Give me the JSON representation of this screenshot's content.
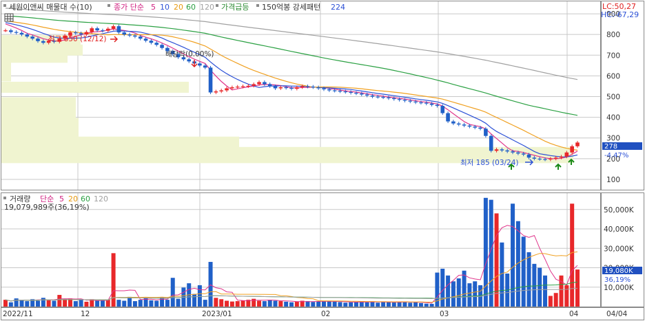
{
  "price_panel": {
    "legend": {
      "title": "세원이앤씨 매물대 수(10)",
      "ma_prefix": "종가 단순",
      "ma_periods": [
        "5",
        "10",
        "20",
        "60",
        "120"
      ],
      "ma_colors": [
        "#e0348a",
        "#2b50d6",
        "#f0a020",
        "#2aa042",
        "#a0a0a0"
      ],
      "price_spike": "가격급등",
      "strong_pattern": "150억봉 강세패턴",
      "strong_count": "224"
    },
    "lc_label": "LC:50,27",
    "hc_label": "HC:-67,29",
    "y_axis": {
      "ticks": [
        "900",
        "800",
        "700",
        "600",
        "500",
        "400",
        "300",
        "200",
        "100"
      ],
      "values": [
        900,
        800,
        700,
        600,
        500,
        400,
        300,
        200,
        100
      ],
      "range": [
        50,
        960
      ]
    },
    "current_price_tag": "278",
    "current_change_tag": "-4.47%",
    "annotations": {
      "high": "최고 850 (12/12)",
      "low": "최저 185 (03/24)",
      "dividend": "배당락(0.00%)"
    }
  },
  "volume_panel": {
    "legend": {
      "title": "거래량",
      "ma_prefix": "단순",
      "ma_periods": [
        "5",
        "20",
        "60",
        "120"
      ]
    },
    "info": "19,079,989주(36,19%)",
    "y_axis": {
      "ticks": [
        "50,000K",
        "40,000K",
        "30,000K",
        "20,000K",
        "10,000K"
      ],
      "values": [
        50000,
        40000,
        30000,
        20000,
        10000
      ],
      "range": [
        0,
        57000
      ]
    },
    "current_volume_tag": "19,080K",
    "current_ratio_tag": "36,19%"
  },
  "x_axis": {
    "labels": [
      "2022/11",
      "12",
      "2023/01",
      "02",
      "03",
      "04"
    ],
    "right_label": "04/04"
  },
  "colors": {
    "up": "#e8282a",
    "down": "#2060c8",
    "grid": "#c8c8c8",
    "profile": "#f0f4d0",
    "tag_bg": "#2050c0"
  },
  "chart_data": {
    "type": "candlestick",
    "title": "세원이앤씨",
    "x_range": [
      "2022/11",
      "2023/04/04"
    ],
    "y_range": [
      50,
      960
    ],
    "close": [
      820,
      812,
      808,
      800,
      790,
      780,
      768,
      760,
      770,
      765,
      780,
      795,
      810,
      806,
      800,
      812,
      830,
      820,
      818,
      828,
      840,
      810,
      800,
      795,
      790,
      780,
      770,
      760,
      750,
      735,
      720,
      705,
      690,
      680,
      670,
      660,
      650,
      640,
      520,
      525,
      530,
      540,
      545,
      548,
      550,
      552,
      560,
      570,
      560,
      550,
      540,
      545,
      542,
      538,
      545,
      550,
      548,
      545,
      540,
      535,
      530,
      528,
      525,
      522,
      518,
      515,
      510,
      505,
      500,
      498,
      496,
      492,
      488,
      484,
      480,
      476,
      472,
      470,
      466,
      460,
      455,
      420,
      380,
      370,
      365,
      360,
      355,
      350,
      345,
      310,
      238,
      245,
      240,
      235,
      230,
      225,
      220,
      205,
      200,
      198,
      196,
      200,
      205,
      210,
      230,
      260,
      278
    ],
    "volume_k": [
      3500,
      2200,
      4200,
      3500,
      2800,
      3800,
      3000,
      4500,
      3200,
      3000,
      6000,
      3500,
      4200,
      2800,
      3500,
      2500,
      3800,
      3000,
      3200,
      3500,
      27500,
      3500,
      3000,
      5000,
      2800,
      3500,
      4500,
      3200,
      3000,
      4800,
      3500,
      14800,
      4000,
      9800,
      12000,
      6500,
      11000,
      3500,
      23000,
      4500,
      3800,
      3000,
      2600,
      2800,
      3200,
      3500,
      4000,
      3000,
      2800,
      3500,
      3000,
      2800,
      2500,
      2200,
      2500,
      3000,
      2800,
      2400,
      2500,
      3000,
      2800,
      2500,
      2300,
      2000,
      2200,
      2500,
      2800,
      2200,
      2600,
      2000,
      2400,
      2300,
      2100,
      2500,
      2600,
      2000,
      2200,
      1800,
      1500,
      1400,
      17500,
      19500,
      16000,
      13000,
      14500,
      18500,
      12000,
      13000,
      11000,
      56000,
      55000,
      48000,
      33000,
      17000,
      53000,
      44000,
      36000,
      28000,
      22000,
      20000,
      16000,
      5500,
      7000,
      16000,
      11000,
      53000,
      19080
    ]
  }
}
